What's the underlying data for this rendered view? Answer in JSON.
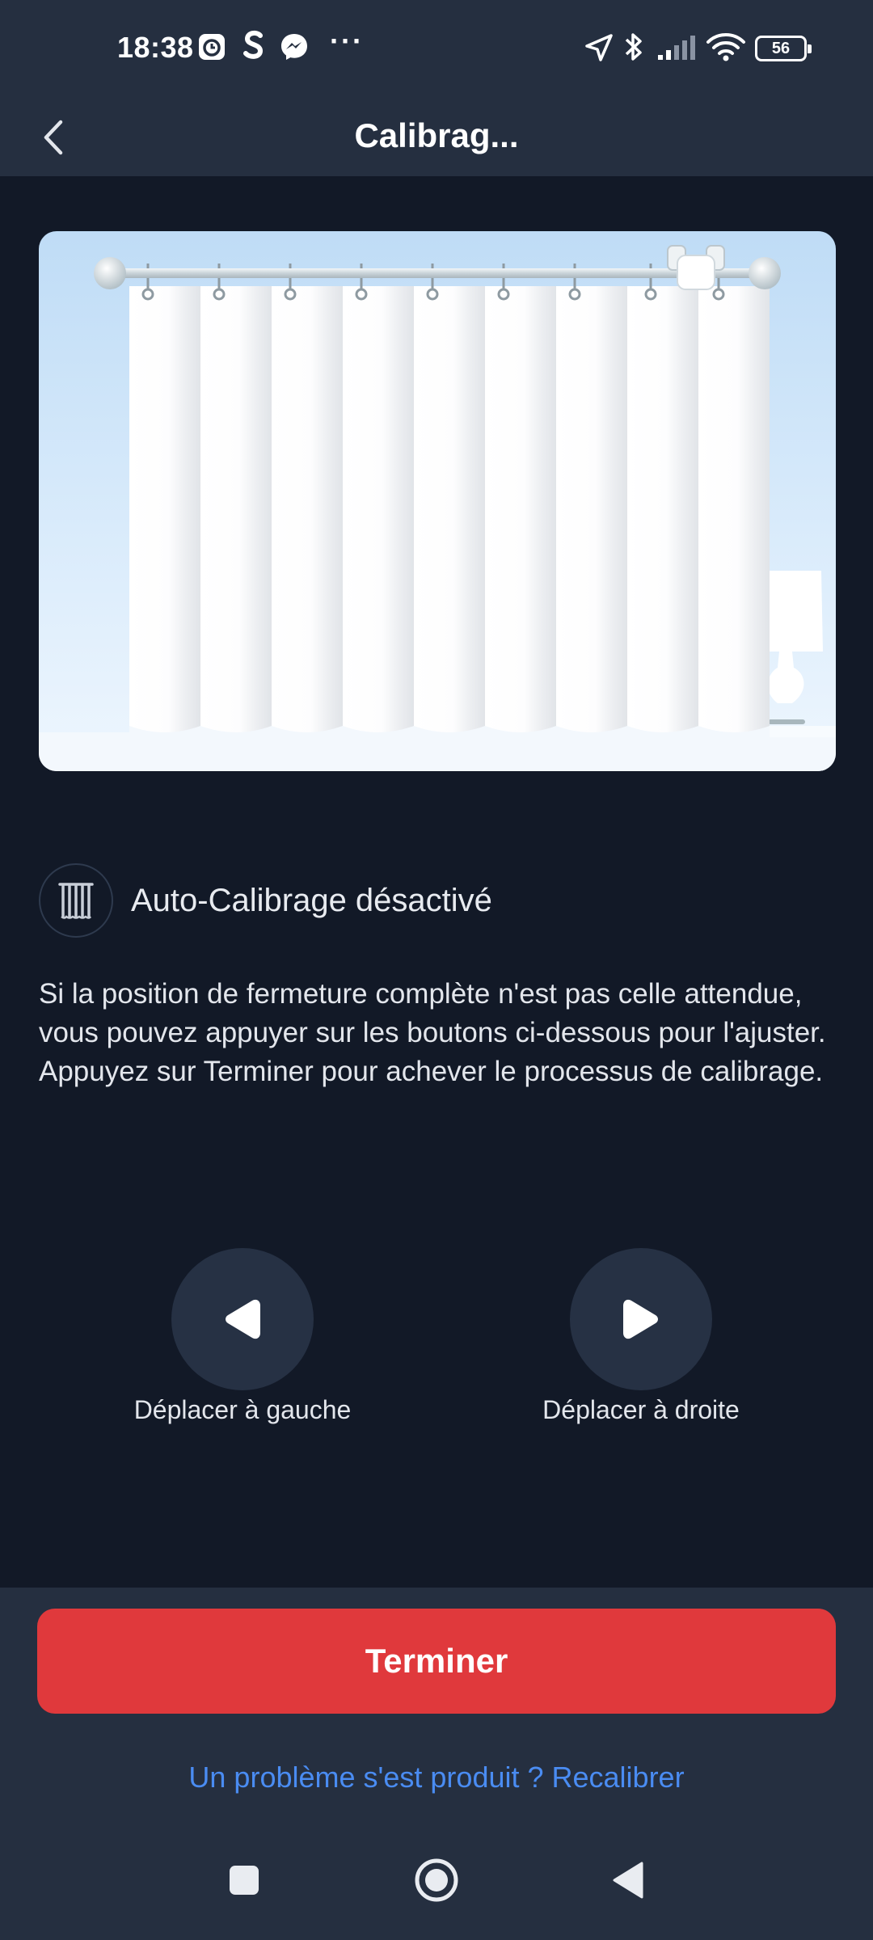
{
  "status_bar": {
    "time": "18:38",
    "battery": "56",
    "left_icons": [
      "alarm-app-icon",
      "s-app-icon",
      "messenger-icon",
      "more-dots-icon"
    ],
    "right_icons": [
      "location-icon",
      "bluetooth-icon",
      "signal-icon",
      "wifi-icon",
      "battery-icon"
    ],
    "dots": "···"
  },
  "header": {
    "title": "Calibrag..."
  },
  "mode": {
    "label": "Auto-Calibrage désactivé",
    "icon": "curtain-icon"
  },
  "description": "Si la position de fermeture complète n'est pas celle attendue, vous pouvez appuyer sur les boutons ci-dessous pour l'ajuster. Appuyez sur Terminer pour achever le processus de calibrage.",
  "controls": {
    "move_left_label": "Déplacer à gauche",
    "move_right_label": "Déplacer à droite"
  },
  "actions": {
    "finish_label": "Terminer",
    "recalibrate_link": "Un problème s'est produit ? Recalibrer"
  },
  "colors": {
    "background": "#121927",
    "panel": "#252f40",
    "accent_red": "#e0393c",
    "link_blue": "#4a8cf2"
  }
}
